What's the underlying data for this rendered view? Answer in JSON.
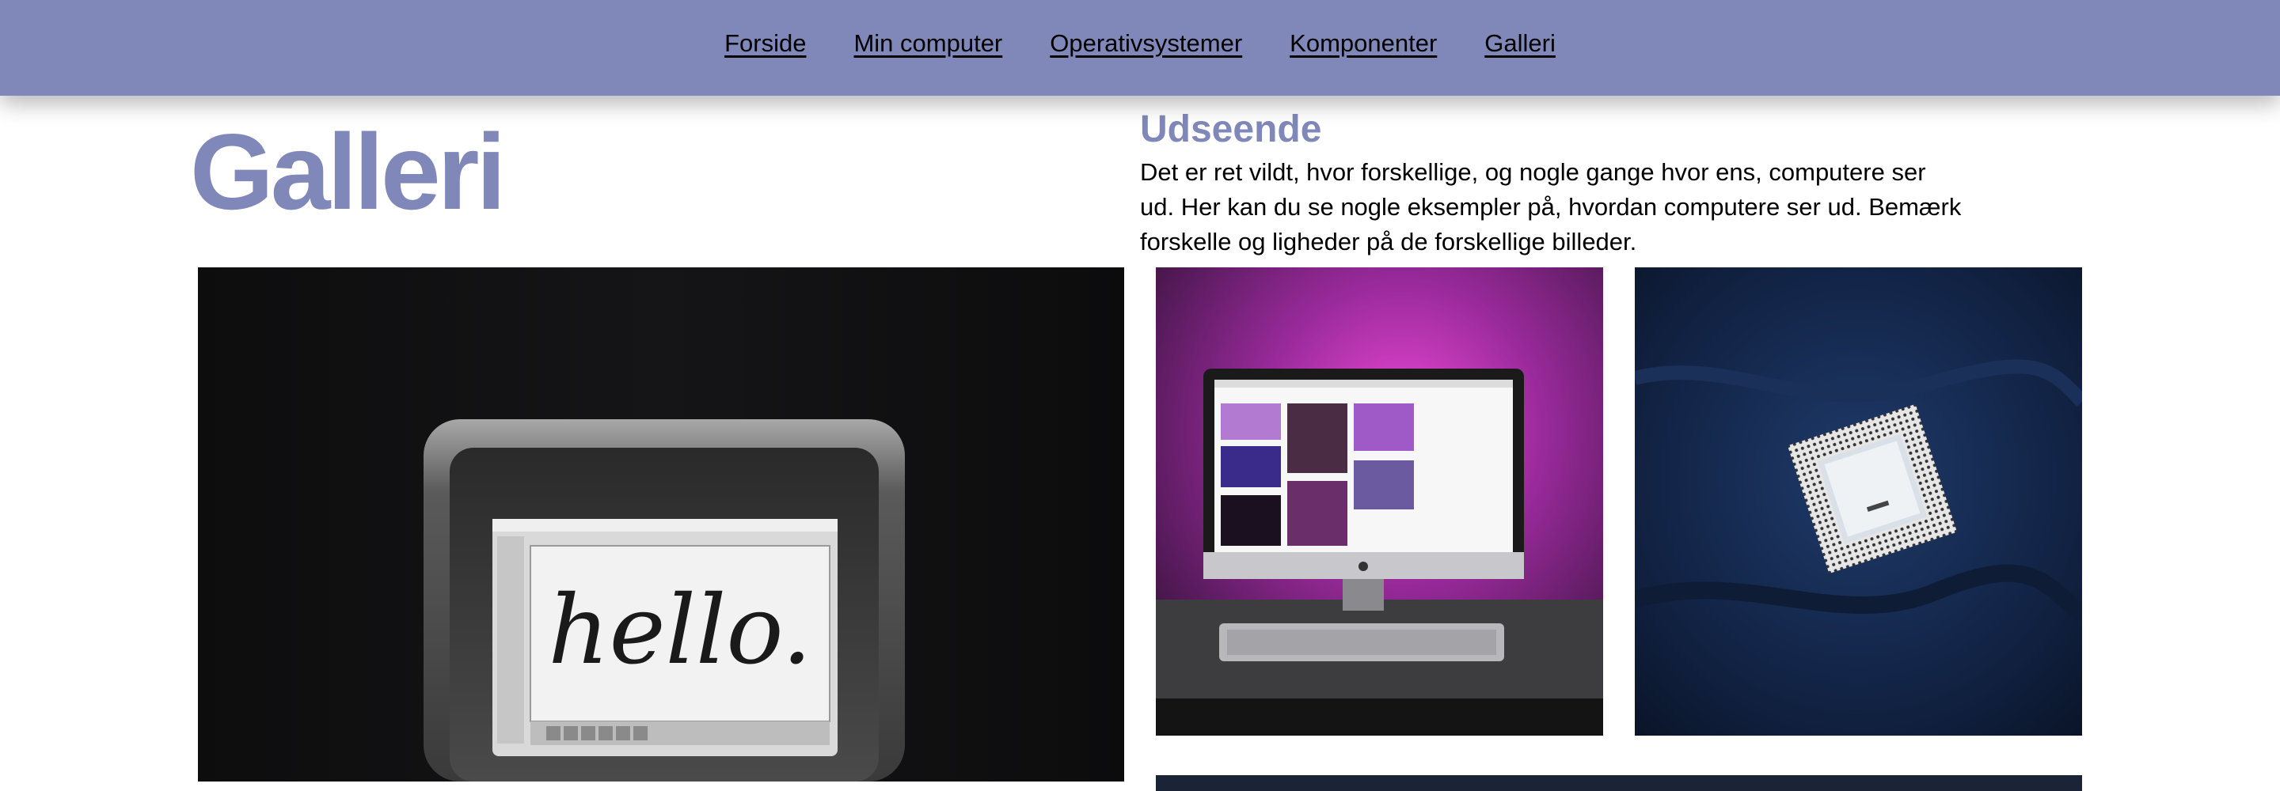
{
  "nav": {
    "items": [
      {
        "label": "Forside"
      },
      {
        "label": "Min computer"
      },
      {
        "label": "Operativsystemer"
      },
      {
        "label": "Komponenter"
      },
      {
        "label": "Galleri"
      }
    ]
  },
  "page": {
    "title": "Galleri"
  },
  "section": {
    "title": "Udseende",
    "intro": "Det er ret vildt, hvor forskellige, og nogle gange hvor ens, computere ser ud. Her kan du se nogle eksempler på, hvordan computere ser ud. Bemærk forskelle og ligheder på de forskellige billeder."
  },
  "gallery": {
    "retro_screen_text": "hello."
  },
  "colors": {
    "accent": "#8088b9",
    "text": "#000000",
    "background": "#ffffff"
  }
}
